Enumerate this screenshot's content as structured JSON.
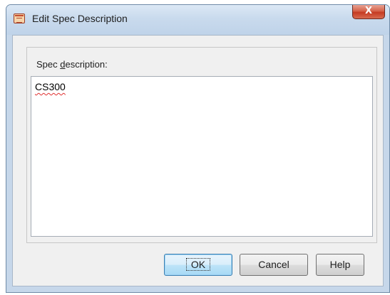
{
  "window": {
    "title": "Edit Spec Description",
    "app_icon": "form-icon",
    "close_label": "X"
  },
  "form": {
    "label_prefix": "Spec ",
    "label_mnemonic": "d",
    "label_suffix": "escription:",
    "value": "CS300"
  },
  "buttons": {
    "ok": "OK",
    "cancel": "Cancel",
    "help": "Help"
  },
  "colors": {
    "title_bar": "#c6d7ea",
    "close_button": "#c53a22",
    "default_button": "#a7d9f5"
  }
}
